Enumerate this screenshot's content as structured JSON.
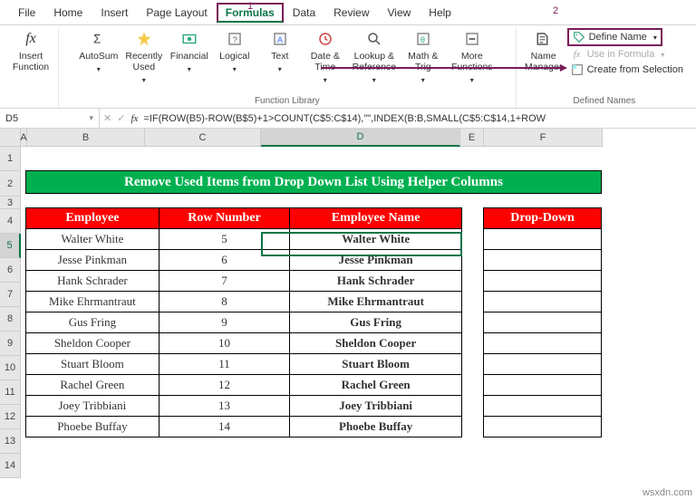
{
  "menu": {
    "file": "File",
    "home": "Home",
    "insert": "Insert",
    "pagelayout": "Page Layout",
    "formulas": "Formulas",
    "data": "Data",
    "review": "Review",
    "view": "View",
    "help": "Help"
  },
  "ribbon": {
    "insertfn": "Insert Function",
    "autosum": "AutoSum",
    "recent": "Recently Used",
    "financial": "Financial",
    "logical": "Logical",
    "text": "Text",
    "datetime": "Date & Time",
    "lookup": "Lookup & Reference",
    "math": "Math & Trig",
    "more": "More Functions",
    "namemgr": "Name Manager",
    "definename": "Define Name",
    "useinformula": "Use in Formula",
    "createfromsel": "Create from Selection",
    "grp1": "Function Library",
    "grp2": "Defined Names"
  },
  "callouts": {
    "c1": "1",
    "c2": "2"
  },
  "namebox": "D5",
  "formula": "=IF(ROW(B5)-ROW(B$5)+1>COUNT(C$5:C$14),\"\",INDEX(B:B,SMALL(C$5:C$14,1+ROW",
  "cols": {
    "A": "A",
    "B": "B",
    "C": "C",
    "D": "D",
    "E": "E",
    "F": "F"
  },
  "rows": [
    "1",
    "2",
    "3",
    "4",
    "5",
    "6",
    "7",
    "8",
    "9",
    "10",
    "11",
    "12",
    "13",
    "14"
  ],
  "banner": "Remove Used Items from Drop Down List Using Helper Columns",
  "headers": {
    "employee": "Employee",
    "rownum": "Row Number",
    "empname": "Employee Name",
    "dropdown": "Drop-Down"
  },
  "table": [
    {
      "emp": "Walter White",
      "row": "5",
      "name": "Walter White"
    },
    {
      "emp": "Jesse Pinkman",
      "row": "6",
      "name": "Jesse Pinkman"
    },
    {
      "emp": "Hank Schrader",
      "row": "7",
      "name": "Hank Schrader"
    },
    {
      "emp": "Mike Ehrmantraut",
      "row": "8",
      "name": "Mike Ehrmantraut"
    },
    {
      "emp": "Gus Fring",
      "row": "9",
      "name": "Gus Fring"
    },
    {
      "emp": "Sheldon Cooper",
      "row": "10",
      "name": "Sheldon Cooper"
    },
    {
      "emp": "Stuart Bloom",
      "row": "11",
      "name": "Stuart Bloom"
    },
    {
      "emp": "Rachel Green",
      "row": "12",
      "name": "Rachel Green"
    },
    {
      "emp": "Joey Tribbiani",
      "row": "13",
      "name": "Joey Tribbiani"
    },
    {
      "emp": "Phoebe Buffay",
      "row": "14",
      "name": "Phoebe Buffay"
    }
  ],
  "watermark": "wsxdn.com",
  "fx": "fx",
  "down": "▾",
  "dropdown_arrow": "▾"
}
